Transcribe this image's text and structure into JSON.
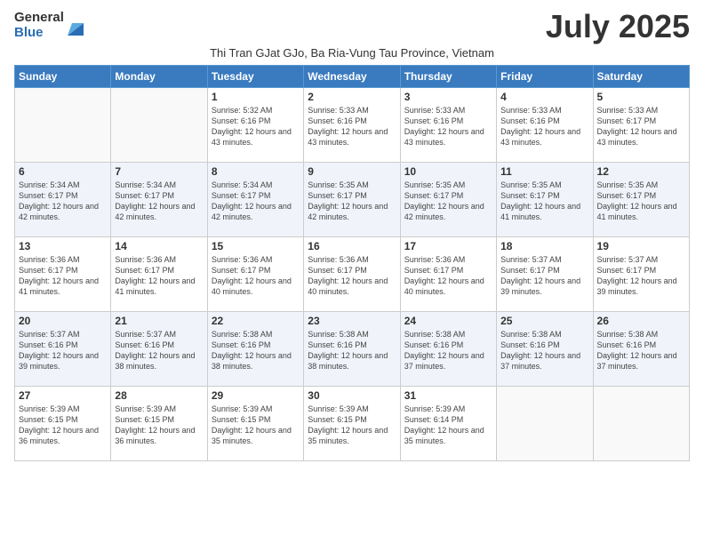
{
  "logo": {
    "general": "General",
    "blue": "Blue"
  },
  "title": "July 2025",
  "subtitle": "Thi Tran GJat GJo, Ba Ria-Vung Tau Province, Vietnam",
  "weekdays": [
    "Sunday",
    "Monday",
    "Tuesday",
    "Wednesday",
    "Thursday",
    "Friday",
    "Saturday"
  ],
  "weeks": [
    [
      {
        "day": "",
        "info": ""
      },
      {
        "day": "",
        "info": ""
      },
      {
        "day": "1",
        "info": "Sunrise: 5:32 AM\nSunset: 6:16 PM\nDaylight: 12 hours and 43 minutes."
      },
      {
        "day": "2",
        "info": "Sunrise: 5:33 AM\nSunset: 6:16 PM\nDaylight: 12 hours and 43 minutes."
      },
      {
        "day": "3",
        "info": "Sunrise: 5:33 AM\nSunset: 6:16 PM\nDaylight: 12 hours and 43 minutes."
      },
      {
        "day": "4",
        "info": "Sunrise: 5:33 AM\nSunset: 6:16 PM\nDaylight: 12 hours and 43 minutes."
      },
      {
        "day": "5",
        "info": "Sunrise: 5:33 AM\nSunset: 6:17 PM\nDaylight: 12 hours and 43 minutes."
      }
    ],
    [
      {
        "day": "6",
        "info": "Sunrise: 5:34 AM\nSunset: 6:17 PM\nDaylight: 12 hours and 42 minutes."
      },
      {
        "day": "7",
        "info": "Sunrise: 5:34 AM\nSunset: 6:17 PM\nDaylight: 12 hours and 42 minutes."
      },
      {
        "day": "8",
        "info": "Sunrise: 5:34 AM\nSunset: 6:17 PM\nDaylight: 12 hours and 42 minutes."
      },
      {
        "day": "9",
        "info": "Sunrise: 5:35 AM\nSunset: 6:17 PM\nDaylight: 12 hours and 42 minutes."
      },
      {
        "day": "10",
        "info": "Sunrise: 5:35 AM\nSunset: 6:17 PM\nDaylight: 12 hours and 42 minutes."
      },
      {
        "day": "11",
        "info": "Sunrise: 5:35 AM\nSunset: 6:17 PM\nDaylight: 12 hours and 41 minutes."
      },
      {
        "day": "12",
        "info": "Sunrise: 5:35 AM\nSunset: 6:17 PM\nDaylight: 12 hours and 41 minutes."
      }
    ],
    [
      {
        "day": "13",
        "info": "Sunrise: 5:36 AM\nSunset: 6:17 PM\nDaylight: 12 hours and 41 minutes."
      },
      {
        "day": "14",
        "info": "Sunrise: 5:36 AM\nSunset: 6:17 PM\nDaylight: 12 hours and 41 minutes."
      },
      {
        "day": "15",
        "info": "Sunrise: 5:36 AM\nSunset: 6:17 PM\nDaylight: 12 hours and 40 minutes."
      },
      {
        "day": "16",
        "info": "Sunrise: 5:36 AM\nSunset: 6:17 PM\nDaylight: 12 hours and 40 minutes."
      },
      {
        "day": "17",
        "info": "Sunrise: 5:36 AM\nSunset: 6:17 PM\nDaylight: 12 hours and 40 minutes."
      },
      {
        "day": "18",
        "info": "Sunrise: 5:37 AM\nSunset: 6:17 PM\nDaylight: 12 hours and 39 minutes."
      },
      {
        "day": "19",
        "info": "Sunrise: 5:37 AM\nSunset: 6:17 PM\nDaylight: 12 hours and 39 minutes."
      }
    ],
    [
      {
        "day": "20",
        "info": "Sunrise: 5:37 AM\nSunset: 6:16 PM\nDaylight: 12 hours and 39 minutes."
      },
      {
        "day": "21",
        "info": "Sunrise: 5:37 AM\nSunset: 6:16 PM\nDaylight: 12 hours and 38 minutes."
      },
      {
        "day": "22",
        "info": "Sunrise: 5:38 AM\nSunset: 6:16 PM\nDaylight: 12 hours and 38 minutes."
      },
      {
        "day": "23",
        "info": "Sunrise: 5:38 AM\nSunset: 6:16 PM\nDaylight: 12 hours and 38 minutes."
      },
      {
        "day": "24",
        "info": "Sunrise: 5:38 AM\nSunset: 6:16 PM\nDaylight: 12 hours and 37 minutes."
      },
      {
        "day": "25",
        "info": "Sunrise: 5:38 AM\nSunset: 6:16 PM\nDaylight: 12 hours and 37 minutes."
      },
      {
        "day": "26",
        "info": "Sunrise: 5:38 AM\nSunset: 6:16 PM\nDaylight: 12 hours and 37 minutes."
      }
    ],
    [
      {
        "day": "27",
        "info": "Sunrise: 5:39 AM\nSunset: 6:15 PM\nDaylight: 12 hours and 36 minutes."
      },
      {
        "day": "28",
        "info": "Sunrise: 5:39 AM\nSunset: 6:15 PM\nDaylight: 12 hours and 36 minutes."
      },
      {
        "day": "29",
        "info": "Sunrise: 5:39 AM\nSunset: 6:15 PM\nDaylight: 12 hours and 35 minutes."
      },
      {
        "day": "30",
        "info": "Sunrise: 5:39 AM\nSunset: 6:15 PM\nDaylight: 12 hours and 35 minutes."
      },
      {
        "day": "31",
        "info": "Sunrise: 5:39 AM\nSunset: 6:14 PM\nDaylight: 12 hours and 35 minutes."
      },
      {
        "day": "",
        "info": ""
      },
      {
        "day": "",
        "info": ""
      }
    ]
  ]
}
